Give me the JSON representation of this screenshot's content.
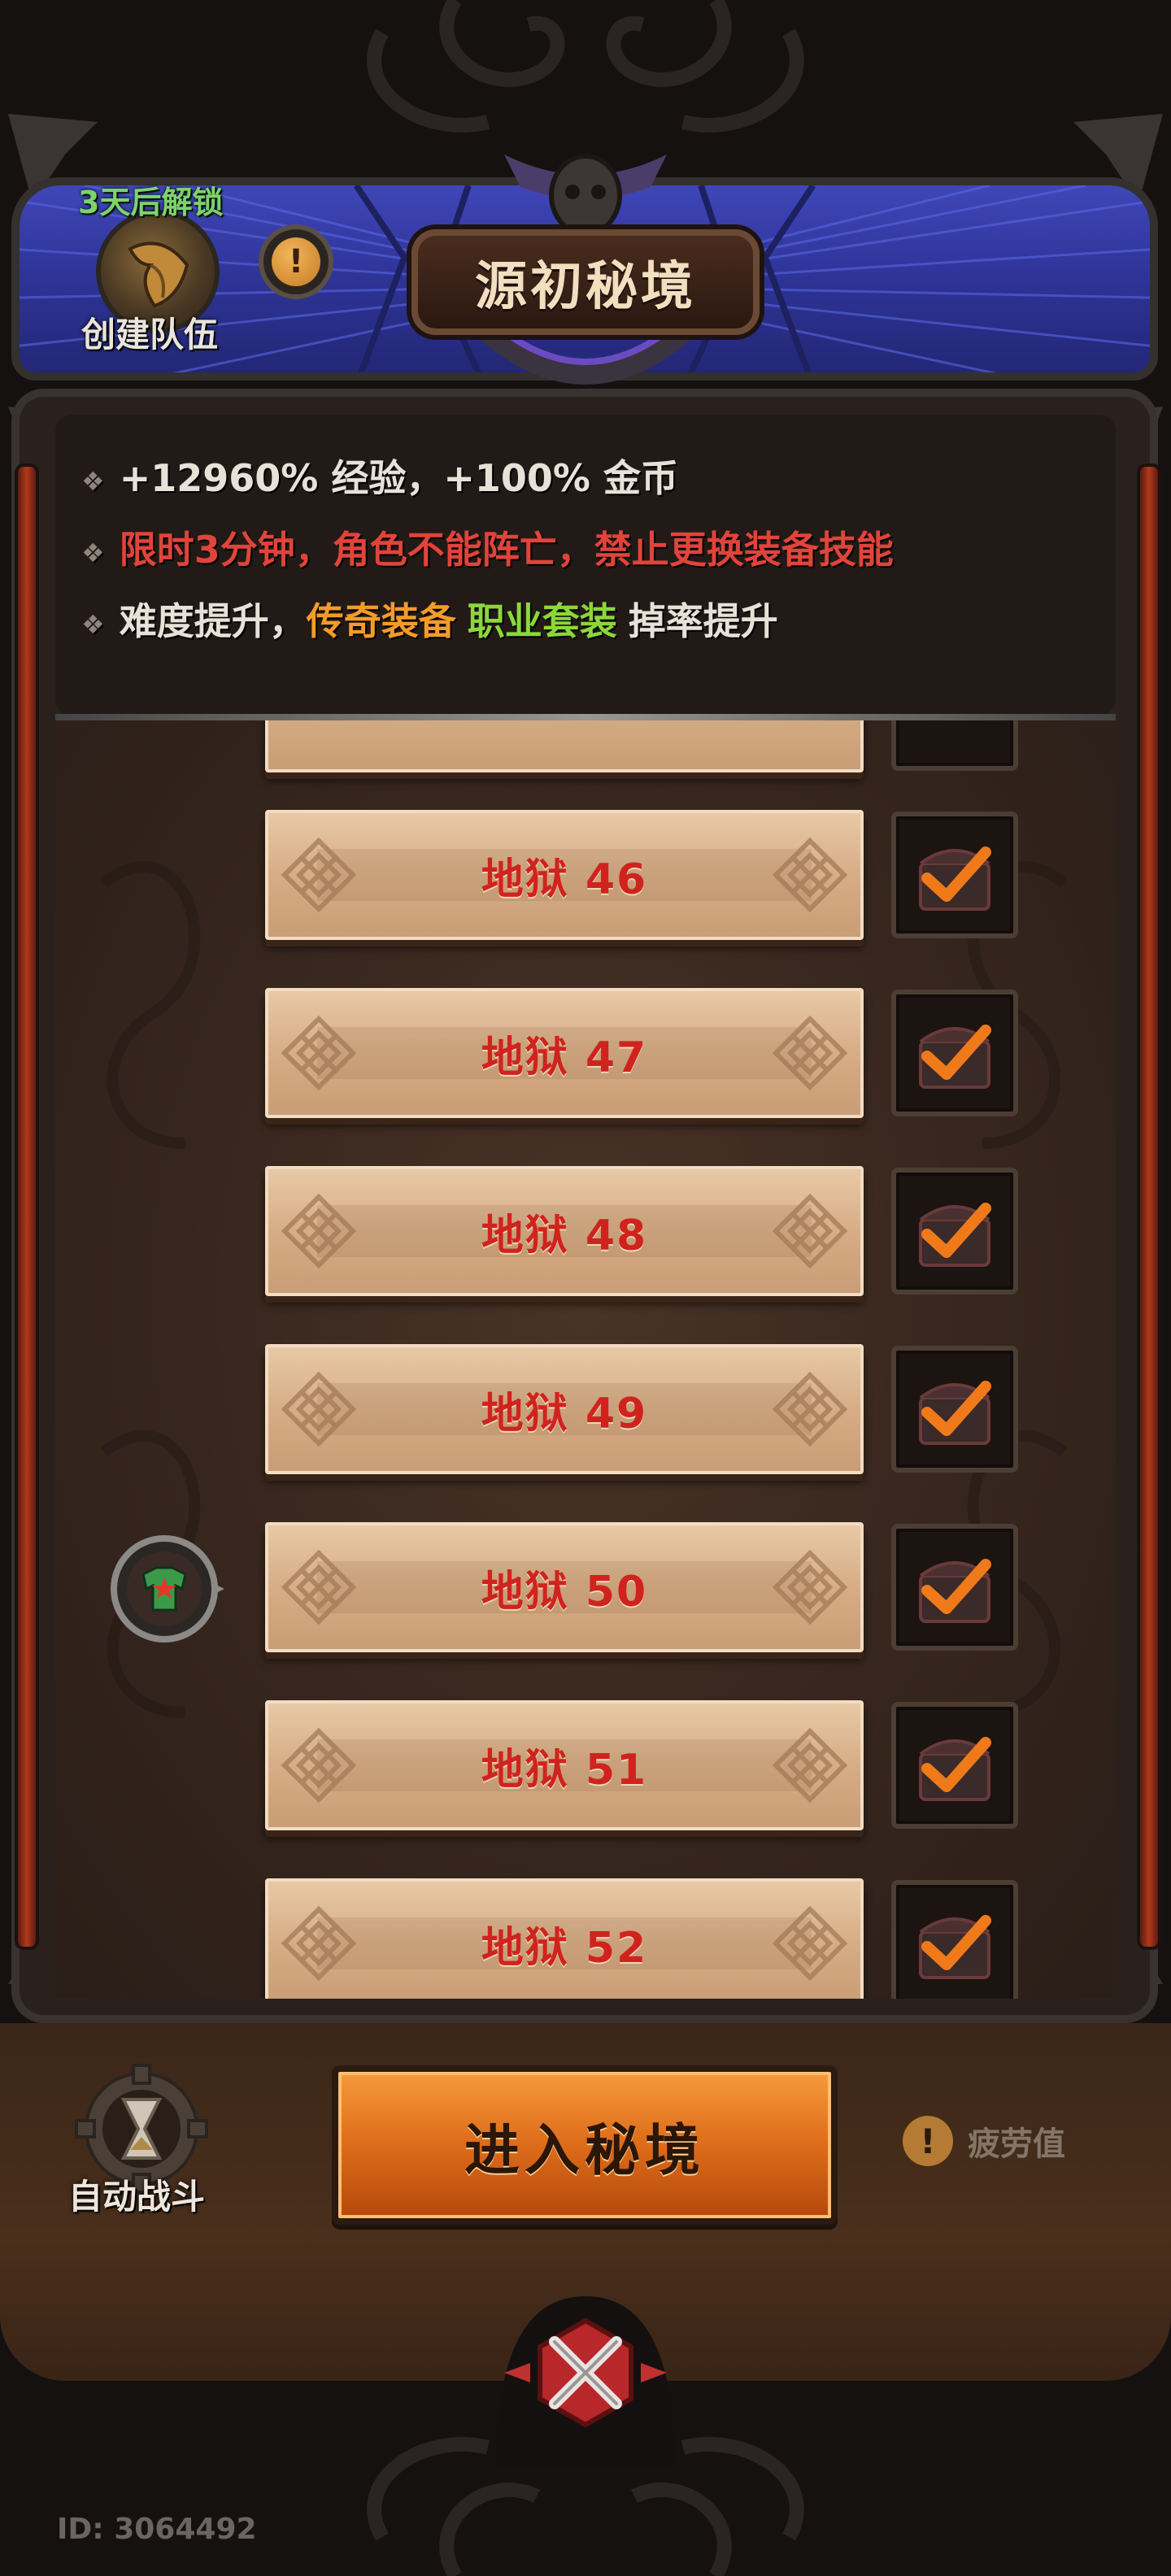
{
  "header": {
    "unlock_text": "3天后解锁",
    "team_label": "创建队伍",
    "title": "源初秘境",
    "info_glyph": "!"
  },
  "info": {
    "line1": "+12960% 经验，+100% 金币",
    "line2": "限时3分钟，角色不能阵亡，禁止更换装备技能",
    "line3_prefix": "难度提升，",
    "line3_legend": "传奇装备",
    "line3_class": "职业套装",
    "line3_suffix": "掉率提升",
    "bullet": "❖"
  },
  "levels": [
    {
      "label": "地狱 46",
      "claimed": true
    },
    {
      "label": "地狱 47",
      "claimed": true
    },
    {
      "label": "地狱 48",
      "claimed": true
    },
    {
      "label": "地狱 49",
      "claimed": true
    },
    {
      "label": "地狱 50",
      "claimed": true,
      "current": true
    },
    {
      "label": "地狱 51",
      "claimed": true
    },
    {
      "label": "地狱 52",
      "claimed": true
    }
  ],
  "bottom": {
    "auto_battle": "自动战斗",
    "enter_button": "进入秘境",
    "fatigue_label": "疲劳值",
    "fatigue_glyph": "!"
  },
  "footer": {
    "id": "ID: 3064492"
  },
  "colors": {
    "accent_red": "#e0443a",
    "accent_orange": "#f39b2a",
    "accent_green": "#8cd63c",
    "unlock_green": "#7cd46a",
    "level_text": "#d0231d",
    "check_orange": "#f07a1a"
  }
}
